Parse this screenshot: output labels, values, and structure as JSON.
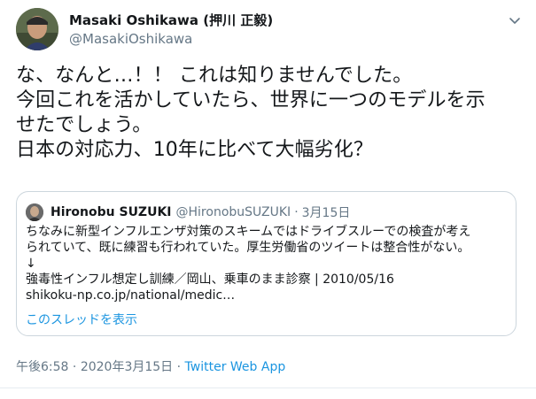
{
  "tweet": {
    "display_name": "Masaki Oshikawa (押川 正毅)",
    "handle": "@MasakiOshikawa",
    "body_lines": [
      "な、なんと…！！ これは知りませんでした。",
      "今回これを活かしていたら、世界に一つのモデルを示",
      "せたでしょう。",
      "日本の対応力、10年に比べて大幅劣化？"
    ],
    "time": "午後6:58",
    "date": "2020年3月15日",
    "source": "Twitter Web App",
    "separator": "·"
  },
  "quoted": {
    "display_name": "Hironobu SUZUKI",
    "handle": "@HironobuSUZUKI",
    "date": "3月15日",
    "text_lines": [
      "ちなみに新型インフルエンザ対策のスキームではドライブスルーでの検査が考え",
      "られていて、既に練習も行われていた。厚生労働省のツイートは整合性がない。",
      "↓",
      "強毒性インフル想定し訓練／岡山、乗車のまま診察 | 2010/05/16",
      "shikoku-np.co.jp/national/medic…"
    ],
    "show_thread": "このスレッドを表示"
  },
  "icons": [
    "avatar",
    "chevron-down-icon",
    "quoted-avatar"
  ],
  "colors": {
    "link": "#1b95e0",
    "secondary": "#657786",
    "border": "#ccd6dd"
  }
}
